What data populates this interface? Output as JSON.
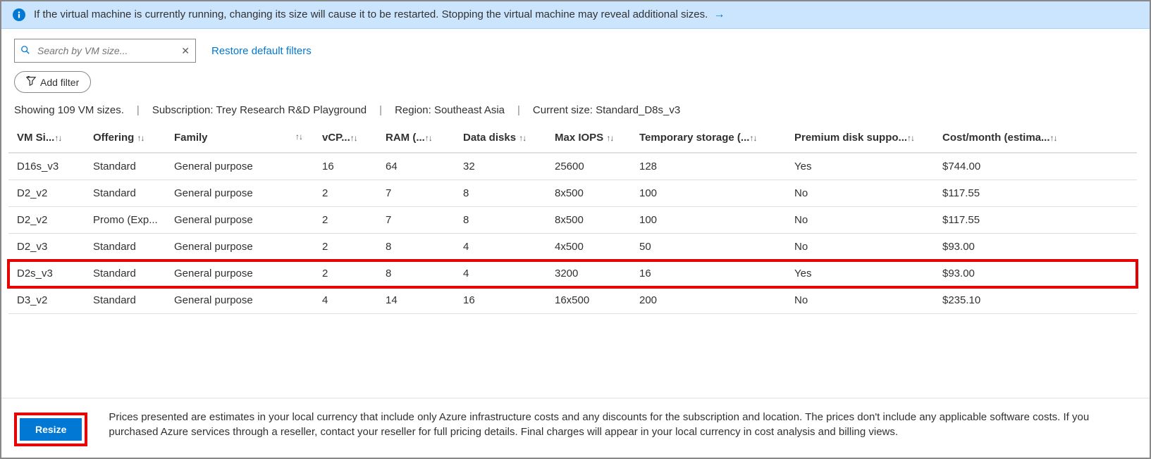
{
  "banner": {
    "text": "If the virtual machine is currently running, changing its size will cause it to be restarted. Stopping the virtual machine may reveal additional sizes."
  },
  "search": {
    "placeholder": "Search by VM size..."
  },
  "links": {
    "restore_filters": "Restore default filters"
  },
  "filters": {
    "add_filter": "Add filter"
  },
  "status": {
    "count_text": "Showing 109 VM sizes.",
    "subscription_label": "Subscription:",
    "subscription_value": "Trey Research R&D Playground",
    "region_label": "Region:",
    "region_value": "Southeast Asia",
    "current_label": "Current size:",
    "current_value": "Standard_D8s_v3"
  },
  "columns": {
    "size": "VM Si...",
    "offering": "Offering",
    "family": "Family",
    "vcpu": "vCP...",
    "ram": "RAM (...",
    "data_disks": "Data disks",
    "max_iops": "Max IOPS",
    "temp_storage": "Temporary storage (...",
    "premium": "Premium disk suppo...",
    "cost": "Cost/month (estima..."
  },
  "rows": [
    {
      "size": "D16s_v3",
      "offering": "Standard",
      "family": "General purpose",
      "vcpu": "16",
      "ram": "64",
      "data_disks": "32",
      "max_iops": "25600",
      "temp_storage": "128",
      "premium": "Yes",
      "cost": "$744.00",
      "highlight": false
    },
    {
      "size": "D2_v2",
      "offering": "Standard",
      "family": "General purpose",
      "vcpu": "2",
      "ram": "7",
      "data_disks": "8",
      "max_iops": "8x500",
      "temp_storage": "100",
      "premium": "No",
      "cost": "$117.55",
      "highlight": false
    },
    {
      "size": "D2_v2",
      "offering": "Promo (Exp...",
      "family": "General purpose",
      "vcpu": "2",
      "ram": "7",
      "data_disks": "8",
      "max_iops": "8x500",
      "temp_storage": "100",
      "premium": "No",
      "cost": "$117.55",
      "highlight": false
    },
    {
      "size": "D2_v3",
      "offering": "Standard",
      "family": "General purpose",
      "vcpu": "2",
      "ram": "8",
      "data_disks": "4",
      "max_iops": "4x500",
      "temp_storage": "50",
      "premium": "No",
      "cost": "$93.00",
      "highlight": false
    },
    {
      "size": "D2s_v3",
      "offering": "Standard",
      "family": "General purpose",
      "vcpu": "2",
      "ram": "8",
      "data_disks": "4",
      "max_iops": "3200",
      "temp_storage": "16",
      "premium": "Yes",
      "cost": "$93.00",
      "highlight": true
    },
    {
      "size": "D3_v2",
      "offering": "Standard",
      "family": "General purpose",
      "vcpu": "4",
      "ram": "14",
      "data_disks": "16",
      "max_iops": "16x500",
      "temp_storage": "200",
      "premium": "No",
      "cost": "$235.10",
      "highlight": false
    }
  ],
  "footer": {
    "resize": "Resize",
    "disclaimer": "Prices presented are estimates in your local currency that include only Azure infrastructure costs and any discounts for the subscription and location. The prices don't include any applicable software costs. If you purchased Azure services through a reseller, contact your reseller for full pricing details. Final charges will appear in your local currency in cost analysis and billing views."
  }
}
